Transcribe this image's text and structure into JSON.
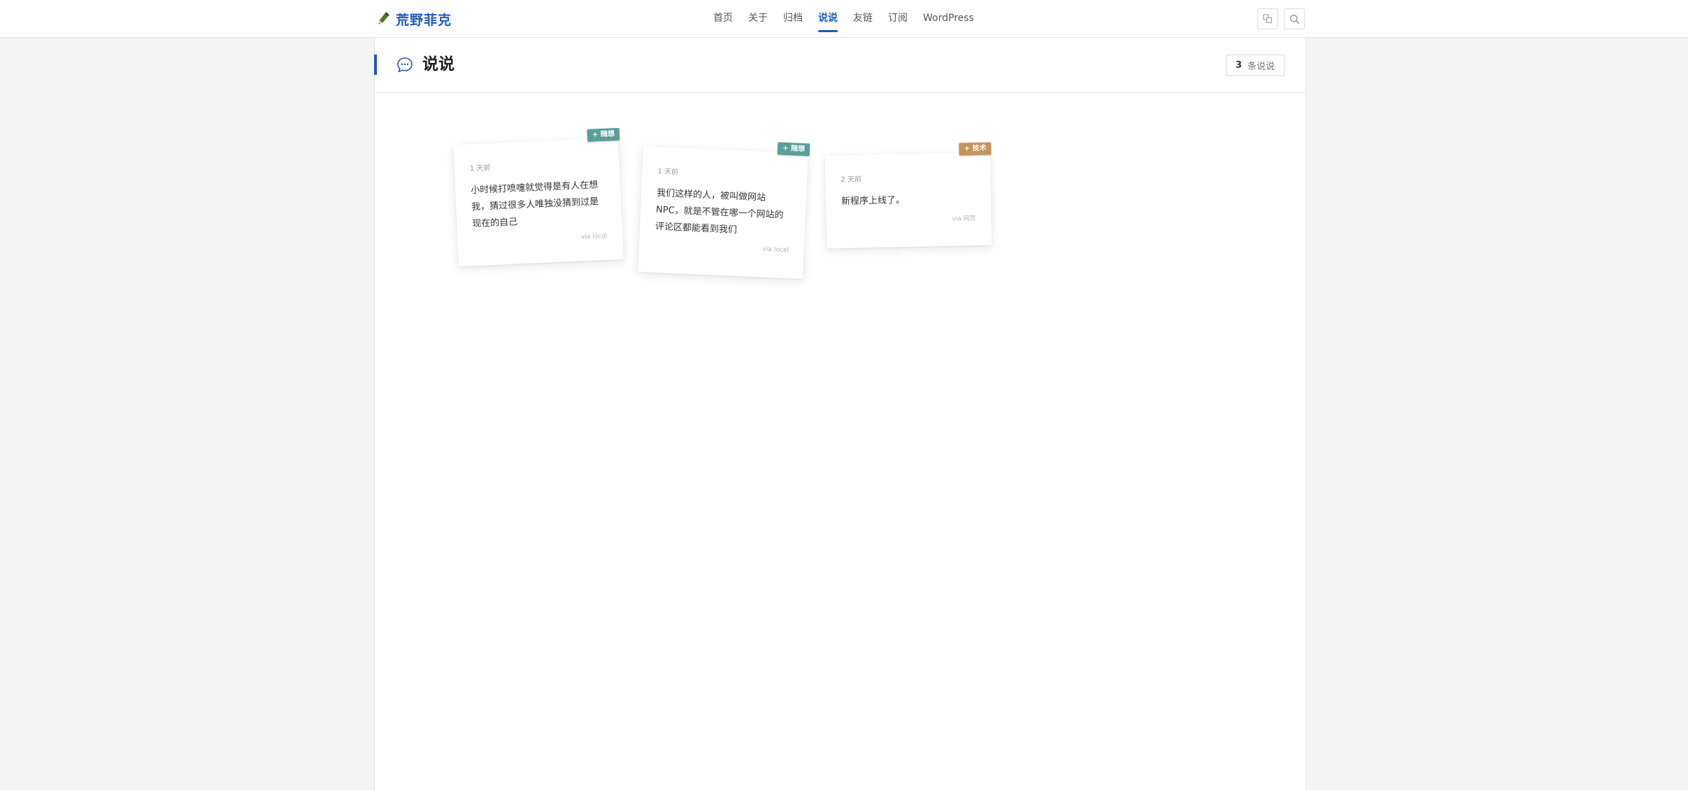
{
  "site": {
    "name": "荒野菲克"
  },
  "nav": {
    "items": [
      "首页",
      "关于",
      "归档",
      "说说",
      "友链",
      "订阅",
      "WordPress"
    ],
    "active": "说说"
  },
  "page": {
    "title": "说说",
    "count_number": "3",
    "count_label": "条说说"
  },
  "notes": [
    {
      "time": "1 天前",
      "text": "小时候打喷嚏就觉得是有人在想我，猜过很多人唯独没猜到过是现在的自己",
      "via": "via local",
      "tag": "+ 随想",
      "tag_color": "#5a9e9a"
    },
    {
      "time": "1 天前",
      "text": "我们这样的人，被叫做网站NPC，就是不管在哪一个网站的评论区都能看到我们",
      "via": "via local",
      "tag": "+ 随想",
      "tag_color": "#5a9e9a"
    },
    {
      "time": "2 天前",
      "text": "新程序上线了。",
      "via": "via 网页",
      "tag": "+ 技术",
      "tag_color": "#c8925a"
    }
  ],
  "colors": {
    "accent": "#1e5bb8",
    "background": "#f4f4f4"
  },
  "icons": {
    "brand": "pencil-icon",
    "translate": "translate-icon",
    "search": "search-icon",
    "page": "chat-bubble-icon"
  }
}
